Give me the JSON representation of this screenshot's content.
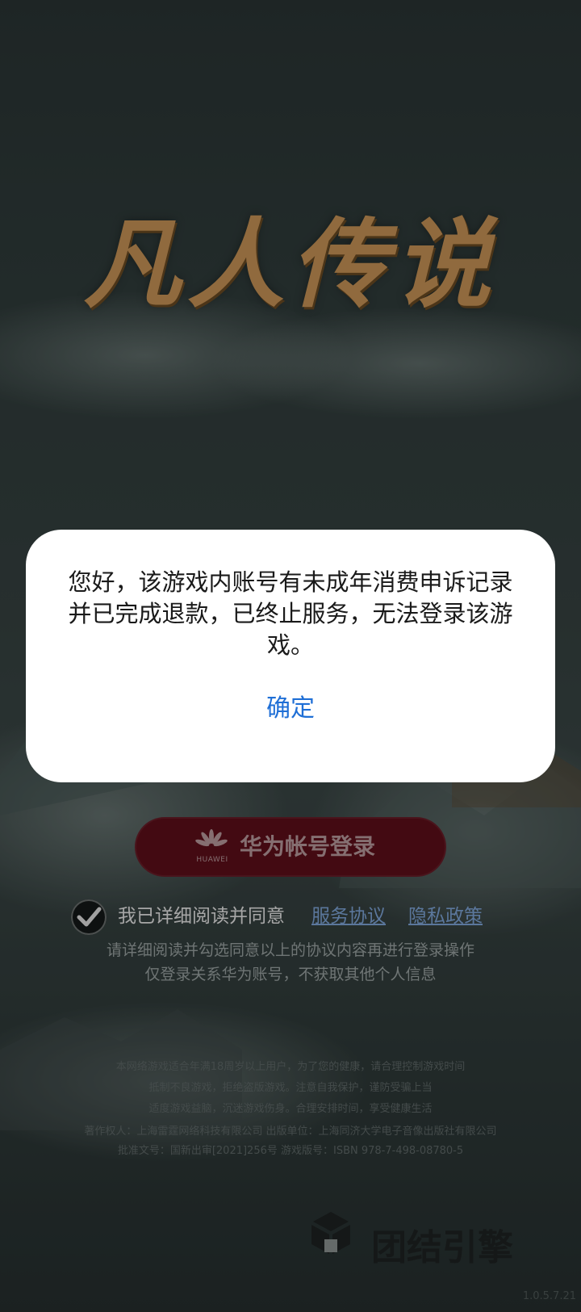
{
  "game": {
    "logo_text": "凡人传说"
  },
  "dialog": {
    "message": "您好，该游戏内账号有未成年消费申诉记录并已完成退款，已终止服务，无法登录该游戏。",
    "confirm_label": "确定"
  },
  "login": {
    "button_label": "华为帐号登录",
    "brand_small": "HUAWEI"
  },
  "agreement": {
    "checked": true,
    "text": "我已详细阅读并同意",
    "service_link": "服务协议",
    "privacy_link": "隐私政策",
    "hint_line1": "请详细阅读并勾选同意以上的协议内容再进行登录操作",
    "hint_line2": "仅登录关系华为账号，不获取其他个人信息"
  },
  "notice": {
    "line1": "本网络游戏适合年满18周岁以上用户，为了您的健康，请合理控制游戏时间",
    "line2": "抵制不良游戏，拒绝盗版游戏。注意自我保护，谨防受骗上当",
    "line3": "适度游戏益脑，沉迷游戏伤身。合理安排时间，享受健康生活",
    "line4": "著作权人：上海雷霆网络科技有限公司      出版单位：上海同济大学电子音像出版社有限公司",
    "line5": "批准文号：国新出审[2021]256号      游戏版号：ISBN 978-7-498-08780-5"
  },
  "engine": {
    "label": "团结引擎"
  },
  "version": "1.0.5.7.21",
  "colors": {
    "dialog_confirm": "#1f6fd6",
    "login_button": "#5e0f1a",
    "logo": "#c89456"
  }
}
